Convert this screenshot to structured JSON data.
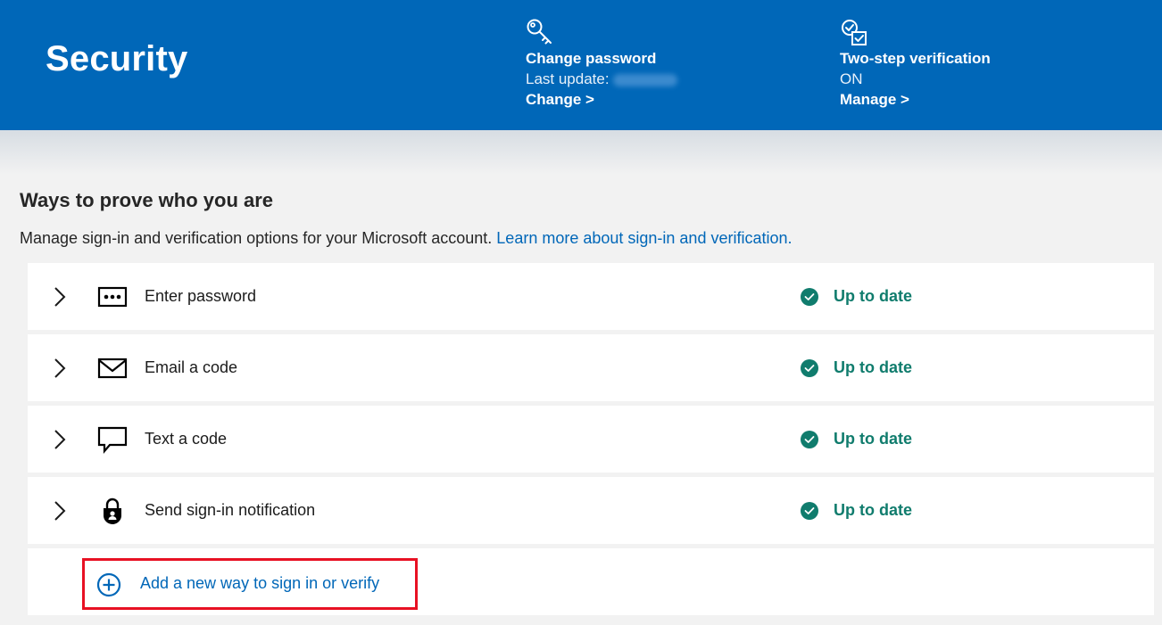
{
  "header": {
    "title": "Security",
    "password_card": {
      "icon": "key-icon",
      "title": "Change password",
      "last_update_label": "Last update:",
      "link": "Change >"
    },
    "two_step_card": {
      "icon": "checklist-icon",
      "title": "Two-step verification",
      "status": "ON",
      "link": "Manage >"
    }
  },
  "section": {
    "title": "Ways to prove who you are",
    "description": "Manage sign-in and verification options for your Microsoft account.",
    "learn_more": "Learn more about sign-in and verification."
  },
  "methods": [
    {
      "label": "Enter password",
      "icon": "password-dots-icon",
      "status": "Up to date"
    },
    {
      "label": "Email a code",
      "icon": "envelope-icon",
      "status": "Up to date"
    },
    {
      "label": "Text a code",
      "icon": "speech-bubble-icon",
      "status": "Up to date"
    },
    {
      "label": "Send sign-in notification",
      "icon": "lock-person-icon",
      "status": "Up to date"
    }
  ],
  "add_method": {
    "label": "Add a new way to sign in or verify",
    "icon": "plus-circle-icon"
  },
  "colors": {
    "header_bg": "#0067b8",
    "status_green": "#107c6d",
    "link_blue": "#0067b8",
    "highlight_red": "#e81123"
  }
}
